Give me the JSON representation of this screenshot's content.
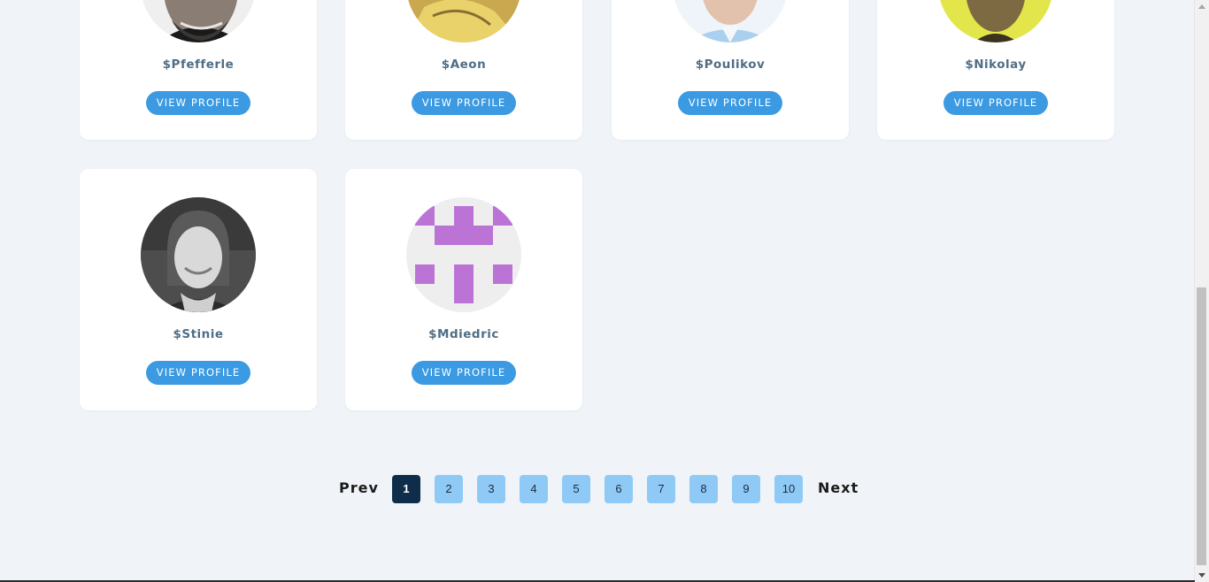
{
  "profiles": [
    {
      "name": "$Pfefferle",
      "button": "VIEW PROFILE"
    },
    {
      "name": "$Aeon",
      "button": "VIEW PROFILE"
    },
    {
      "name": "$Poulikov",
      "button": "VIEW PROFILE"
    },
    {
      "name": "$Nikolay",
      "button": "VIEW PROFILE"
    },
    {
      "name": "$Stinie",
      "button": "VIEW PROFILE"
    },
    {
      "name": "$Mdiedric",
      "button": "VIEW PROFILE"
    }
  ],
  "pagination": {
    "prev": "Prev",
    "next": "Next",
    "pages": [
      "1",
      "2",
      "3",
      "4",
      "5",
      "6",
      "7",
      "8",
      "9",
      "10"
    ],
    "current": "1"
  },
  "colors": {
    "background": "#f0f3f7",
    "button": "#3b9ae2",
    "page_inactive": "#8fcaf7",
    "page_active": "#0d2d4a",
    "name_text": "#4f6e86",
    "identicon": "#bb74d6"
  }
}
